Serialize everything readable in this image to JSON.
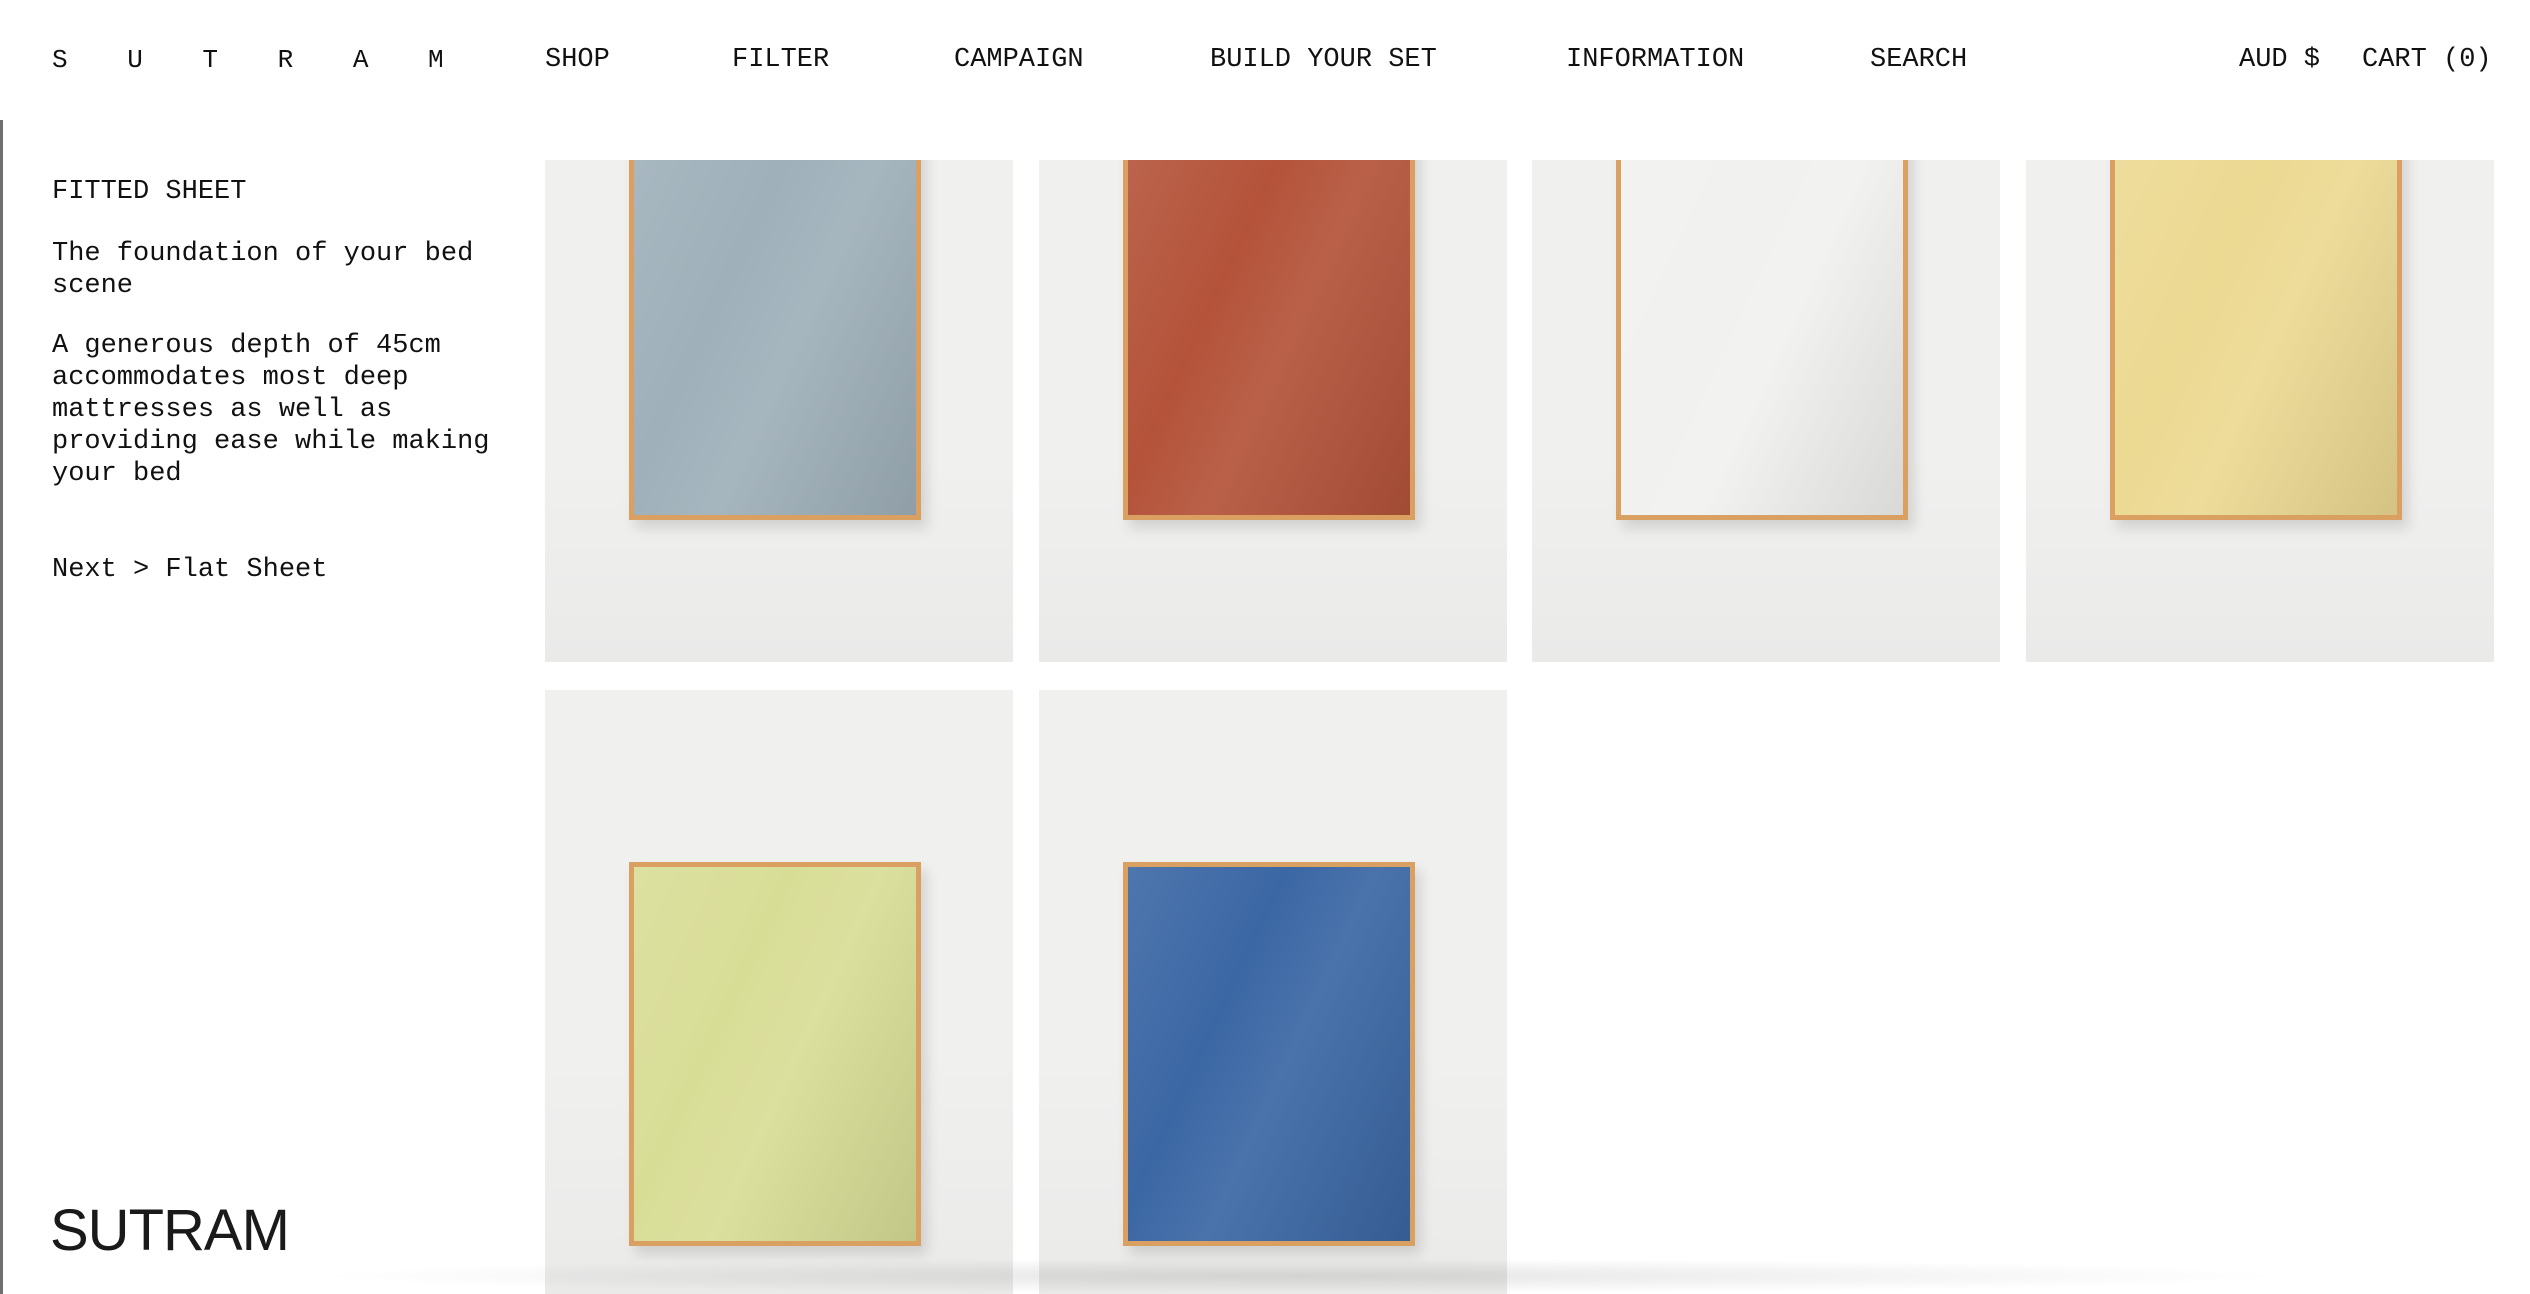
{
  "header": {
    "logo": "S U T R A M",
    "nav": {
      "shop": "SHOP",
      "filter": "FILTER",
      "campaign": "CAMPAIGN",
      "build": "BUILD YOUR SET",
      "information": "INFORMATION",
      "search": "SEARCH"
    },
    "currency": "AUD $",
    "cart": "CART (0)"
  },
  "sidebar": {
    "title": "FITTED SHEET",
    "intro": "The foundation of your bed scene",
    "description": "A generous depth of 45cm accommodates most deep mattresses as well as providing ease while making your bed",
    "next_link": "Next > Flat Sheet"
  },
  "footer": {
    "brand": "SUTRAM"
  },
  "products": [
    {
      "color_name": "slate-blue",
      "color": "#9fb0ba"
    },
    {
      "color_name": "rust",
      "color": "#b4533a"
    },
    {
      "color_name": "white",
      "color": "#f1f1ef"
    },
    {
      "color_name": "butter-yellow",
      "color": "#ecd992"
    },
    {
      "color_name": "lime",
      "color": "#d8dd96"
    },
    {
      "color_name": "cobalt-blue",
      "color": "#3b67a4"
    }
  ],
  "colors": {
    "frame": "#d9a061",
    "card_background": "#f0f0ef"
  }
}
